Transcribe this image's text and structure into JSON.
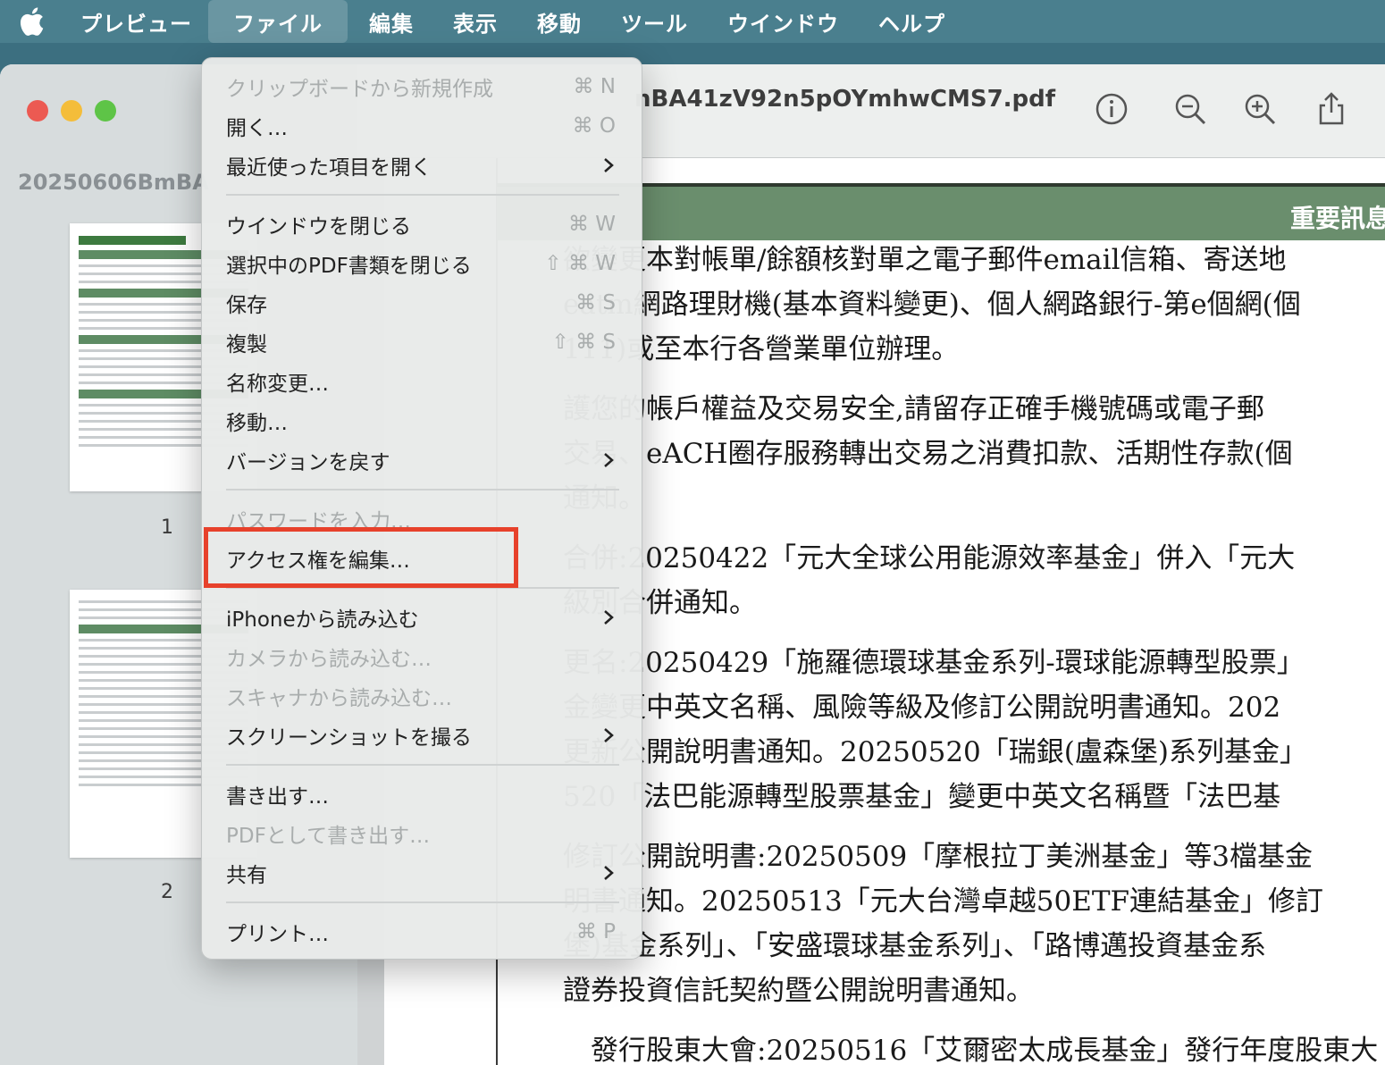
{
  "menubar": {
    "app": "プレビュー",
    "items": [
      "ファイル",
      "編集",
      "表示",
      "移動",
      "ツール",
      "ウインドウ",
      "ヘルプ"
    ]
  },
  "sidebar": {
    "title": "20250606BmBA",
    "pages": [
      "1",
      "2"
    ]
  },
  "toolbar": {
    "doc_title": "nBA41zV92n5pOYmhwCMS7.pdf"
  },
  "document": {
    "banner": "重要訊息",
    "lines": [
      "欲變更本對帳單/餘額核對單之電子郵件email信箱、寄送地",
      "eatm網路理財機(基本資料變更)、個人網路銀行-第e個網(個",
      "111)或至本行各營業單位辦理。",
      "護您的帳戶權益及交易安全,請留存正確手機號碼或電子郵",
      "交易、eACH圈存服務轉出交易之消費扣款、活期性存款(個",
      "通知。",
      "合併:20250422「元大全球公用能源效率基金」併入「元大",
      "級別合併通知。",
      "更名:20250429「施羅德環球基金系列-環球能源轉型股票」",
      "金變更中英文名稱、風險等級及修訂公開說明書通知。202",
      "更新公開說明書通知。20250520「瑞銀(盧森堡)系列基金」",
      "520「法巴能源轉型股票基金」變更中英文名稱暨「法巴基",
      "修訂公開說明書:20250509「摩根拉丁美洲基金」等3檔基金",
      "明書通知。20250513「元大台灣卓越50ETF連結基金」修訂",
      "堡)基金系列」、「安盛環球基金系列」、「路博邁投資基金系",
      "證券投資信託契約暨公開說明書通知。",
      "　發行股東大會:20250516「艾爾密太成長基金」發行年度股東大"
    ]
  },
  "file_menu": {
    "items": [
      {
        "label": "クリップボードから新規作成",
        "shortcut": "⌘ N",
        "disabled": true
      },
      {
        "label": "開く…",
        "shortcut": "⌘ O"
      },
      {
        "label": "最近使った項目を開く",
        "submenu": true
      },
      {
        "label": "ウインドウを閉じる",
        "shortcut": "⌘ W"
      },
      {
        "label": "選択中のPDF書類を閉じる",
        "shortcut": "⇧ ⌘ W"
      },
      {
        "label": "保存",
        "shortcut": "⌘ S"
      },
      {
        "label": "複製",
        "shortcut": "⇧ ⌘ S"
      },
      {
        "label": "名称変更…"
      },
      {
        "label": "移動…"
      },
      {
        "label": "バージョンを戻す",
        "submenu": true
      },
      {
        "label": "パスワードを入力…",
        "disabled": true
      },
      {
        "label": "アクセス権を編集…"
      },
      {
        "label": "iPhoneから読み込む",
        "submenu": true
      },
      {
        "label": "カメラから読み込む…",
        "disabled": true
      },
      {
        "label": "スキャナから読み込む…",
        "disabled": true
      },
      {
        "label": "スクリーンショットを撮る",
        "submenu": true
      },
      {
        "label": "書き出す…"
      },
      {
        "label": "PDFとして書き出す…",
        "disabled": true
      },
      {
        "label": "共有",
        "submenu": true
      },
      {
        "label": "プリント…",
        "shortcut": "⌘ P"
      }
    ]
  },
  "colors": {
    "menubar": "#4a7f8e",
    "highlight": "#e7412b",
    "banner": "#6a8e6d"
  }
}
